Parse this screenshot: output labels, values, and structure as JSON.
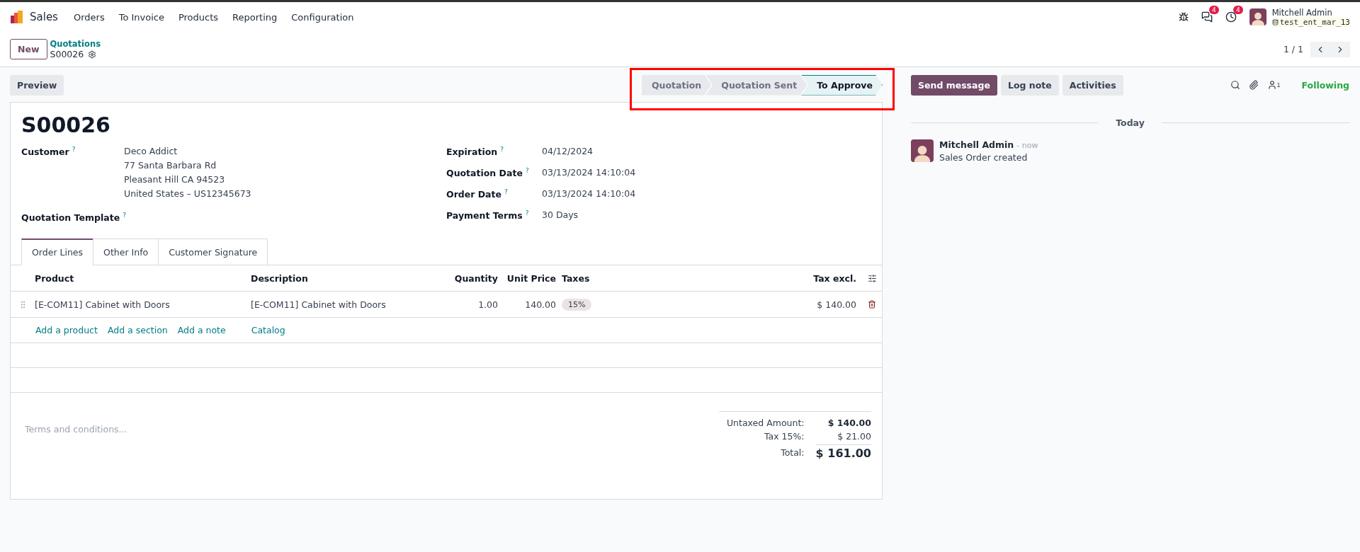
{
  "navbar": {
    "app": "Sales",
    "menu": [
      "Orders",
      "To Invoice",
      "Products",
      "Reporting",
      "Configuration"
    ],
    "systray": [
      {
        "kind": "bug"
      },
      {
        "kind": "messages",
        "badge": "4"
      },
      {
        "kind": "activity",
        "badge": "4"
      }
    ],
    "user": {
      "name": "Mitchell Admin",
      "database": "test_ent_mar_13"
    }
  },
  "control_panel": {
    "new_button": "New",
    "breadcrumb": "Quotations",
    "record": "S00026",
    "pager": "1 / 1"
  },
  "actions": {
    "preview": "Preview"
  },
  "status_bar": [
    {
      "label": "Quotation",
      "selected": false
    },
    {
      "label": "Quotation Sent",
      "selected": false
    },
    {
      "label": "To Approve",
      "selected": true
    }
  ],
  "form": {
    "title": "S00026",
    "left_fields": [
      {
        "label": "Customer",
        "help": "?",
        "lines": [
          "Deco Addict",
          "77 Santa Barbara Rd",
          "Pleasant Hill CA 94523",
          "United States – US12345673"
        ]
      },
      {
        "label": "Quotation Template",
        "help": "?"
      }
    ],
    "right_fields": [
      {
        "label": "Expiration",
        "help": "?",
        "value": "04/12/2024"
      },
      {
        "label": "Quotation Date",
        "help": "?",
        "value": "03/13/2024 14:10:04"
      },
      {
        "label": "Order Date",
        "help": "?",
        "value": "03/13/2024 14:10:04"
      },
      {
        "label": "Payment Terms",
        "help": "?",
        "value": "30 Days"
      }
    ]
  },
  "tabs": [
    {
      "label": "Order Lines",
      "selected": true
    },
    {
      "label": "Other Info",
      "selected": false
    },
    {
      "label": "Customer Signature",
      "selected": false
    }
  ],
  "order_lines": {
    "columns": [
      "Product",
      "Description",
      "Quantity",
      "Unit Price",
      "Taxes",
      "Tax excl."
    ],
    "rows": [
      {
        "product": "[E-COM11] Cabinet with Doors",
        "description": "[E-COM11] Cabinet with Doors",
        "quantity": "1.00",
        "unit_price": "140.00",
        "taxes": "15%",
        "tax_excl": "$ 140.00"
      }
    ],
    "add_links": [
      "Add a product",
      "Add a section",
      "Add a note",
      "Catalog"
    ]
  },
  "terms": {
    "placeholder": "Terms and conditions..."
  },
  "totals": [
    {
      "label": "Untaxed Amount:",
      "value": "$ 140.00",
      "kind": "subtotal"
    },
    {
      "label": "Tax 15%:",
      "value": "$ 21.00",
      "kind": "tax"
    },
    {
      "label": "Total:",
      "value": "$ 161.00",
      "kind": "total"
    }
  ],
  "chatter": {
    "buttons": [
      {
        "label": "Send message",
        "kind": "primary"
      },
      {
        "label": "Log note",
        "kind": "secondary"
      },
      {
        "label": "Activities",
        "kind": "secondary"
      }
    ],
    "followers_count": "1",
    "follow_label": "Following",
    "date_label": "Today",
    "messages": [
      {
        "author": "Mitchell Admin",
        "time": "- now",
        "body": "Sales Order created"
      }
    ]
  }
}
